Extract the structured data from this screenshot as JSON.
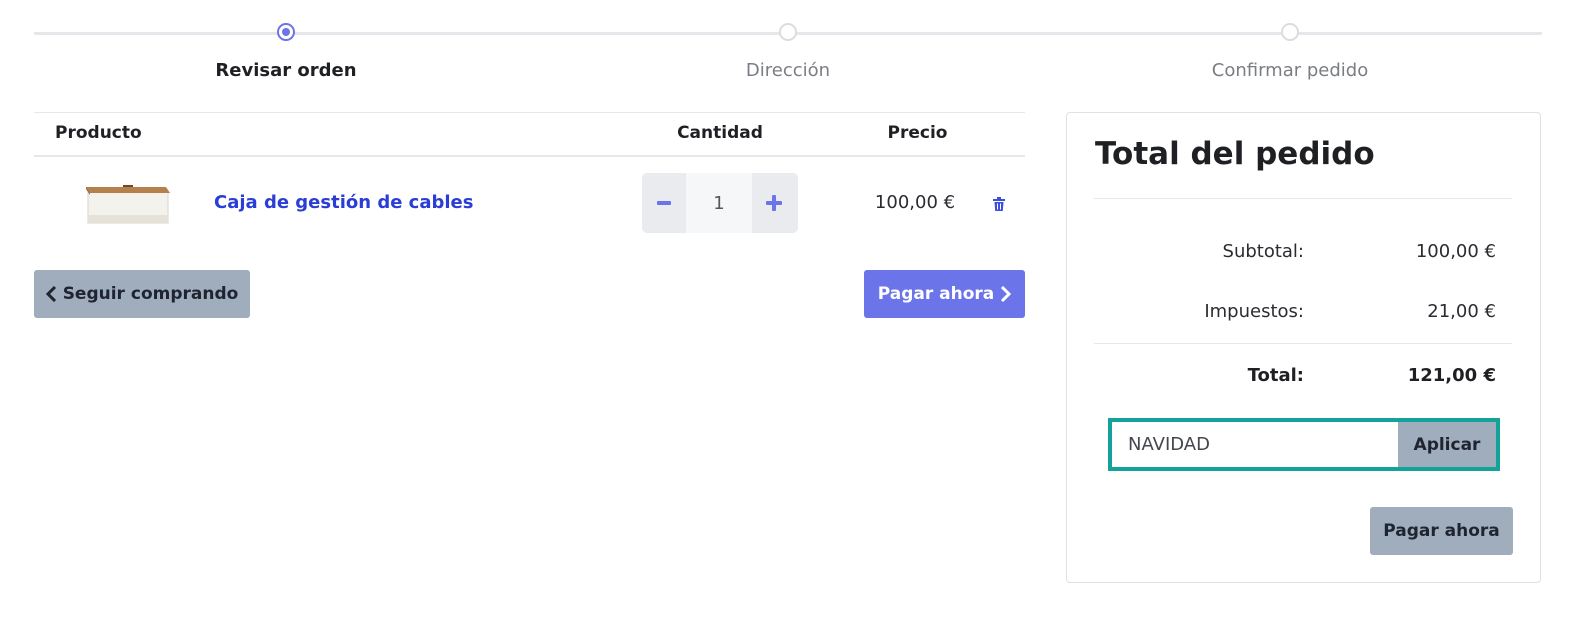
{
  "steps": [
    {
      "label": "Revisar orden",
      "active": true
    },
    {
      "label": "Dirección",
      "active": false
    },
    {
      "label": "Confirmar pedido",
      "active": false
    }
  ],
  "table": {
    "headers": {
      "product": "Producto",
      "quantity": "Cantidad",
      "price": "Precio"
    },
    "items": [
      {
        "name": "Caja de gestión de cables",
        "quantity": "1",
        "price": "100,00 €"
      }
    ]
  },
  "actions": {
    "continue_shopping": "Seguir comprando",
    "pay_now": "Pagar ahora"
  },
  "summary": {
    "title": "Total del pedido",
    "subtotal_label": "Subtotal:",
    "subtotal_value": "100,00 €",
    "taxes_label": "Impuestos:",
    "taxes_value": "21,00 €",
    "total_label": "Total:",
    "total_value": "121,00 €",
    "coupon_value": "NAVIDAD",
    "apply_label": "Aplicar",
    "pay_now": "Pagar ahora"
  },
  "icons": {
    "minus": "minus-icon",
    "plus": "plus-icon",
    "delete": "trash-icon",
    "back": "chevron-left-icon",
    "forward": "chevron-right-icon"
  },
  "colors": {
    "accent": "#6b74e8",
    "link": "#2a3dd6",
    "secondary_button": "#a0adbd",
    "coupon_highlight": "#14a39a"
  }
}
